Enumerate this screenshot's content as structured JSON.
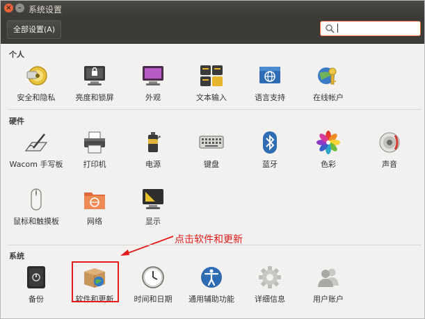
{
  "window": {
    "title": "系统设置"
  },
  "toolbar": {
    "all_settings_label": "全部设置(A)",
    "search_value": ""
  },
  "sections": {
    "personal": {
      "title": "个人",
      "items": [
        {
          "label": "安全和隐私",
          "icon": "security-privacy-icon"
        },
        {
          "label": "亮度和锁屏",
          "icon": "brightness-lock-icon"
        },
        {
          "label": "外观",
          "icon": "appearance-icon"
        },
        {
          "label": "文本输入",
          "icon": "text-entry-icon"
        },
        {
          "label": "语言支持",
          "icon": "language-support-icon"
        },
        {
          "label": "在线帐户",
          "icon": "online-accounts-icon"
        }
      ]
    },
    "hardware": {
      "title": "硬件",
      "items": [
        {
          "label": "Wacom 手写板",
          "icon": "wacom-tablet-icon"
        },
        {
          "label": "打印机",
          "icon": "printer-icon"
        },
        {
          "label": "电源",
          "icon": "power-icon"
        },
        {
          "label": "键盘",
          "icon": "keyboard-icon"
        },
        {
          "label": "蓝牙",
          "icon": "bluetooth-icon"
        },
        {
          "label": "色彩",
          "icon": "color-icon"
        },
        {
          "label": "声音",
          "icon": "sound-icon"
        },
        {
          "label": "鼠标和触摸板",
          "icon": "mouse-touchpad-icon"
        },
        {
          "label": "网络",
          "icon": "network-icon"
        },
        {
          "label": "显示",
          "icon": "display-icon"
        }
      ]
    },
    "system": {
      "title": "系统",
      "items": [
        {
          "label": "备份",
          "icon": "backup-icon"
        },
        {
          "label": "软件和更新",
          "icon": "software-updates-icon"
        },
        {
          "label": "时间和日期",
          "icon": "time-date-icon"
        },
        {
          "label": "通用辅助功能",
          "icon": "universal-access-icon"
        },
        {
          "label": "详细信息",
          "icon": "details-icon"
        },
        {
          "label": "用户账户",
          "icon": "user-accounts-icon"
        }
      ]
    }
  },
  "annotation": {
    "text": "点击软件和更新"
  },
  "colors": {
    "highlight": "#e31b1b",
    "titlebar": "#3c3b37",
    "accent": "#e06a3c"
  }
}
